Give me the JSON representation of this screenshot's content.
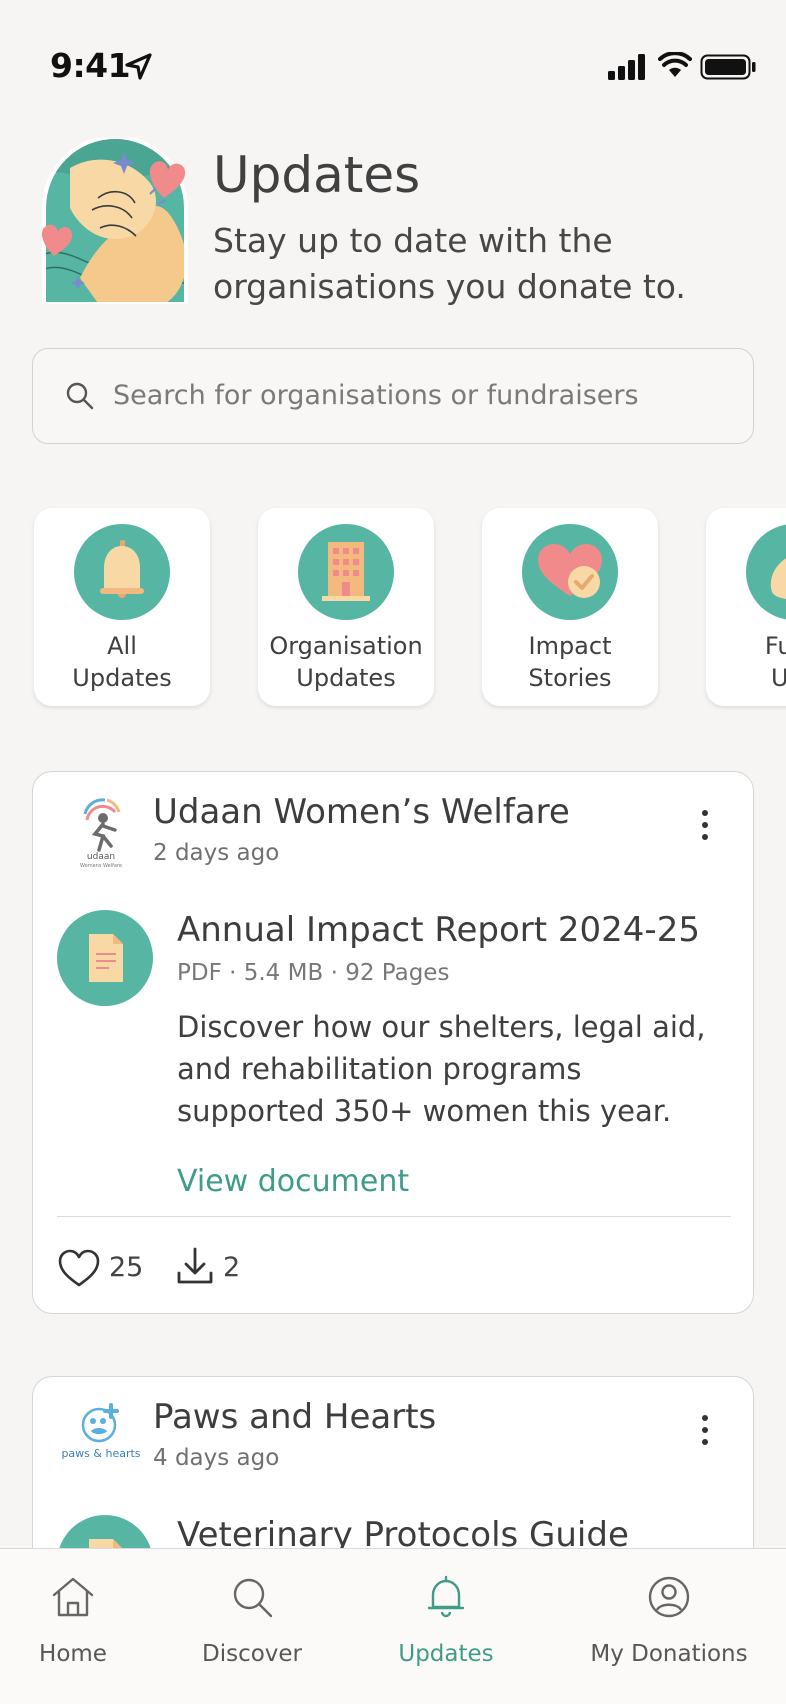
{
  "status_bar": {
    "time": "9:41",
    "icons": [
      "location-arrow-icon",
      "cellular-signal-icon",
      "wifi-icon",
      "battery-icon"
    ]
  },
  "header": {
    "title": "Updates",
    "subtitle": "Stay up to date with the organisations you donate to.",
    "illustration": "hands-with-hearts-illustration"
  },
  "search": {
    "placeholder": "Search for organisations or fundraisers"
  },
  "categories": [
    {
      "label_line1": "All",
      "label_line2": "Updates",
      "icon": "bell-icon"
    },
    {
      "label_line1": "Organisation",
      "label_line2": "Updates",
      "icon": "building-icon"
    },
    {
      "label_line1": "Impact",
      "label_line2": "Stories",
      "icon": "heart-check-icon"
    },
    {
      "label_line1": "Fund",
      "label_line2": "Upc",
      "icon": "money-bag-icon"
    }
  ],
  "posts": [
    {
      "org_name": "Udaan Women’s Welfare",
      "org_logo_text": "udaan",
      "org_logo_subtext": "Womens Welfare",
      "time": "2 days ago",
      "doc_title": "Annual Impact Report 2024-25",
      "doc_meta": "PDF · 5.4 MB · 92 Pages",
      "doc_desc": "Discover how our shelters, legal aid, and rehabilitation programs supported 350+ women this year.",
      "link_label": "View document",
      "likes": "25",
      "downloads": "2"
    },
    {
      "org_name": "Paws and Hearts",
      "org_logo_text": "paws & hearts",
      "time": "4 days ago",
      "doc_title": "Veterinary Protocols Guide"
    }
  ],
  "tab_bar": {
    "tabs": [
      {
        "label": "Home",
        "icon": "home-icon"
      },
      {
        "label": "Discover",
        "icon": "search-icon"
      },
      {
        "label": "Updates",
        "icon": "bell-icon",
        "active": true
      },
      {
        "label": "My Donations",
        "icon": "user-circle-icon"
      }
    ]
  },
  "colors": {
    "accent": "#3f9c89",
    "teal": "#56b6a3",
    "background": "#f6f5f3"
  }
}
